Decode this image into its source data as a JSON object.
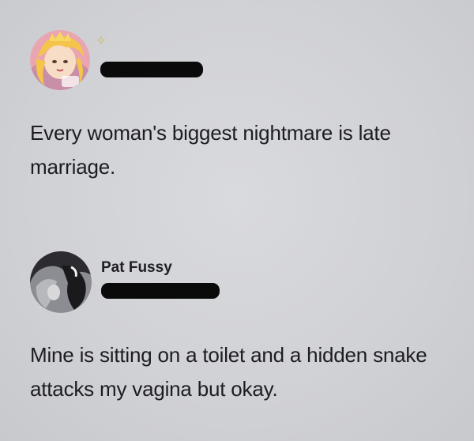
{
  "posts": [
    {
      "author": {
        "name": "",
        "avatar_icon": "cartoon-princess-avatar",
        "badge_icon": "sparkle-icon",
        "badge_glyph": "✧",
        "handle_redacted": true
      },
      "text": "Every woman's biggest nightmare is late marriage."
    },
    {
      "author": {
        "name": "Pat Fussy",
        "avatar_icon": "photo-avatar",
        "handle_redacted": true
      },
      "text": "Mine is sitting on a toilet and a hidden snake attacks my vagina but okay."
    }
  ],
  "colors": {
    "background": "#d2d3d7",
    "text": "#1d1d21",
    "redaction": "#0a0a0a",
    "sparkle": "#cbbb63"
  }
}
